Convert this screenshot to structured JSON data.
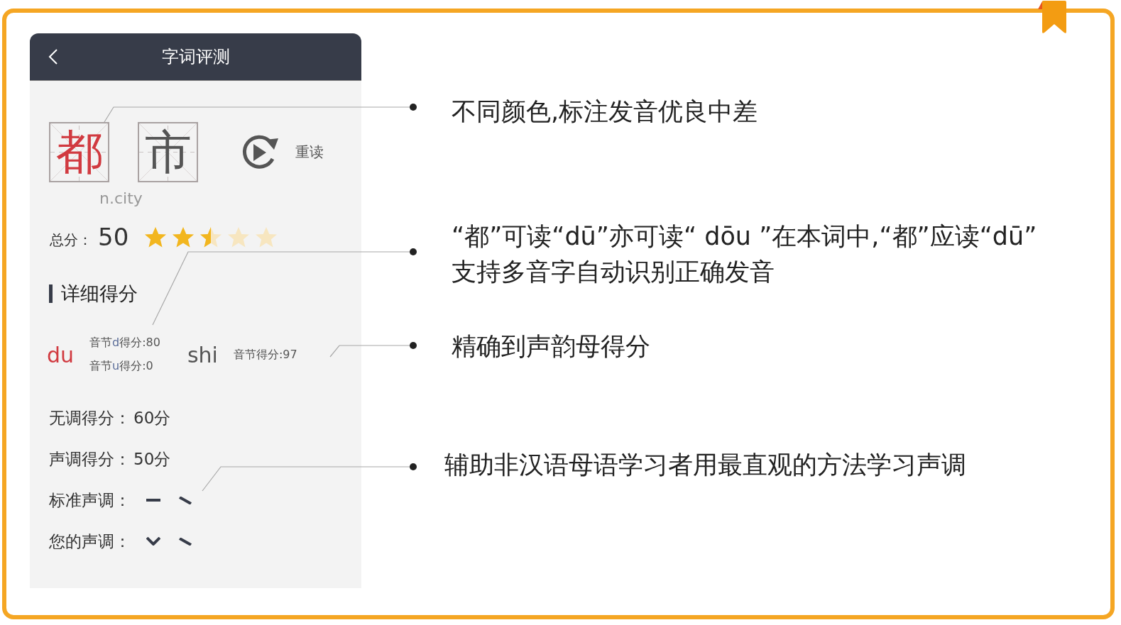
{
  "header": {
    "title": "字词评测"
  },
  "word": {
    "characters": [
      {
        "char": "都",
        "color": "#d13a40"
      },
      {
        "char": "市",
        "color": "#555555"
      }
    ],
    "reread_label": "重读",
    "meaning": "n.city"
  },
  "total": {
    "label": "总分：",
    "score": "50",
    "stars": 2.5
  },
  "detail_title": "详细得分",
  "syllables": [
    {
      "pinyin": "du",
      "color": "#d13a40",
      "scores": [
        {
          "prefix": "音节",
          "letter": "d",
          "suffix": "得分:80"
        },
        {
          "prefix": "音节",
          "letter": "u",
          "suffix": "得分:0"
        }
      ]
    },
    {
      "pinyin": "shi",
      "color": "#555555",
      "scores": [
        {
          "prefix": "音节得分:97"
        }
      ]
    }
  ],
  "summary": [
    {
      "kind": "score",
      "label": "无调得分：",
      "value": "60分"
    },
    {
      "kind": "score",
      "label": "声调得分：",
      "value": "50分"
    },
    {
      "kind": "tones",
      "label": "标准声调：",
      "tones": [
        {
          "kind": "flat"
        },
        {
          "kind": "falling"
        }
      ]
    },
    {
      "kind": "tones",
      "label": "您的声调：",
      "tones": [
        {
          "kind": "dipping"
        },
        {
          "kind": "falling"
        }
      ]
    }
  ],
  "annotations": [
    {
      "lines": [
        "不同颜色,标注发音优良中差"
      ]
    },
    {
      "lines": [
        "“都”可读“dū”亦可读“ dōu ”在本词中,“都”应读“dū”",
        "支持多音字自动识别正确发音"
      ]
    },
    {
      "lines": [
        "精确到声韵母得分"
      ]
    },
    {
      "lines": [
        "辅助非汉语母语学习者用最直观的方法学习声调"
      ]
    }
  ]
}
